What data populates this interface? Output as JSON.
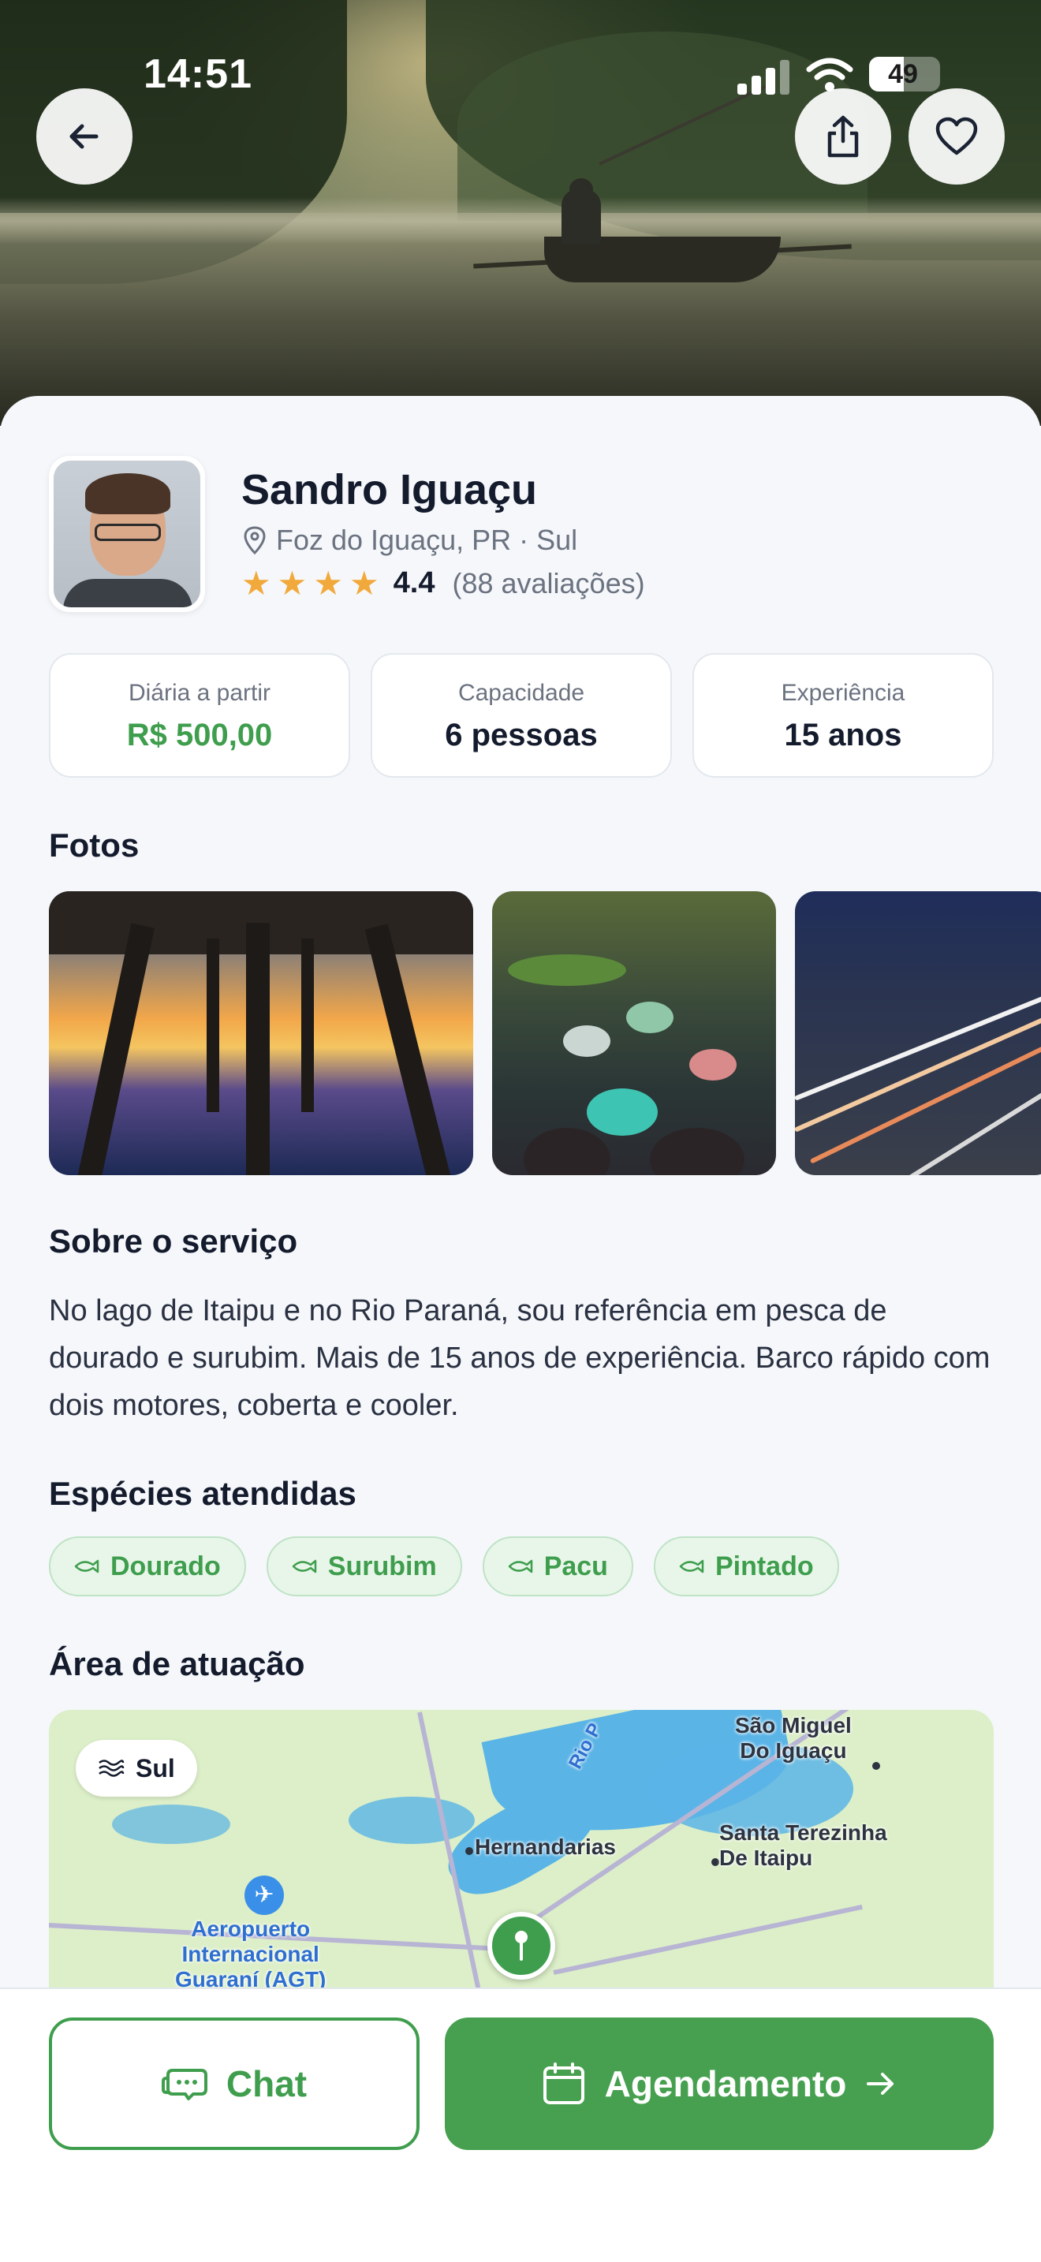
{
  "status_bar": {
    "time": "14:51",
    "battery": "49"
  },
  "guide": {
    "name": "Sandro Iguaçu",
    "location": "Foz do Iguaçu, PR · Sul",
    "rating": "4.4",
    "review_count": "(88 avaliações)",
    "stars": 4.4
  },
  "stats": [
    {
      "label": "Diária a partir",
      "value": "R$ 500,00"
    },
    {
      "label": "Capacidade",
      "value": "6 pessoas"
    },
    {
      "label": "Experiência",
      "value": "15 anos"
    }
  ],
  "sections": {
    "photos": "Fotos",
    "about": "Sobre o serviço",
    "species": "Espécies atendidas",
    "area": "Área de atuação"
  },
  "about_text": "No lago de Itaipu e no Rio Paraná, sou referência em pesca de dourado e surubim. Mais de 15 anos de experiência. Barco rápido com dois motores, coberta e cooler.",
  "species": [
    "Dourado",
    "Surubim",
    "Pacu",
    "Pintado"
  ],
  "map": {
    "region": "Sul",
    "labels": {
      "sao_miguel": "São Miguel\nDo Iguaçu",
      "hernandarias": "Hernandarias",
      "santa_terezinha": "Santa Terezinha\nDe Itaipu",
      "airport": "Aeropuerto\nInternacional\nGuaraní (AGT)",
      "river": "Rio P"
    }
  },
  "actions": {
    "chat": "Chat",
    "booking": "Agendamento"
  },
  "colors": {
    "accent": "#46a04f",
    "star": "#f2a93b"
  }
}
